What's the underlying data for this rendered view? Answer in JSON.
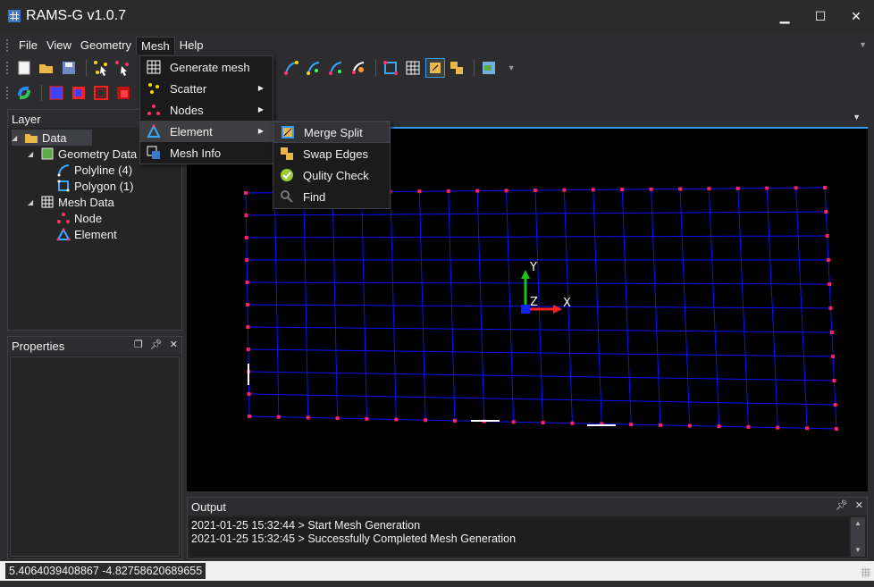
{
  "window": {
    "title": "RAMS-G v1.0.7",
    "minimize": "▁",
    "maximize": "☐",
    "close": "✕"
  },
  "menubar": {
    "items": [
      {
        "label": "File"
      },
      {
        "label": "View"
      },
      {
        "label": "Geometry"
      },
      {
        "label": "Mesh"
      },
      {
        "label": "Help"
      }
    ],
    "active": "Mesh"
  },
  "mesh_menu": {
    "items": [
      {
        "label": "Generate mesh",
        "icon": "generate-mesh-icon",
        "has_submenu": false
      },
      {
        "label": "Scatter",
        "icon": "scatter-icon",
        "has_submenu": true
      },
      {
        "label": "Nodes",
        "icon": "nodes-icon",
        "has_submenu": true
      },
      {
        "label": "Element",
        "icon": "element-icon",
        "has_submenu": true
      },
      {
        "label": "Mesh Info",
        "icon": "mesh-info-icon",
        "has_submenu": false
      }
    ]
  },
  "element_menu": {
    "items": [
      {
        "label": "Merge Split",
        "icon": "merge-split-icon"
      },
      {
        "label": "Swap Edges",
        "icon": "swap-edges-icon"
      },
      {
        "label": "Qulity Check",
        "icon": "quality-check-icon"
      },
      {
        "label": "Find",
        "icon": "find-icon"
      }
    ]
  },
  "layer_panel": {
    "title": "Layer",
    "tree": {
      "root": "Data",
      "geometry": "Geometry Data",
      "polyline": "Polyline (4)",
      "polygon": "Polygon (1)",
      "mesh": "Mesh Data",
      "node": "Node",
      "element": "Element"
    }
  },
  "properties_panel": {
    "title": "Properties"
  },
  "output_panel": {
    "title": "Output",
    "lines": [
      "2021-01-25 15:32:44 > Start Mesh Generation",
      "2021-01-25 15:32:45 > Successfully Completed Mesh Generation"
    ]
  },
  "viewport": {
    "axis_x": "X",
    "axis_y": "Y",
    "axis_z": "Z",
    "mesh_line_color": "#1010ff",
    "node_color": "#ff2060"
  },
  "status": {
    "coordinates": "5.4064039408867 -4.82758620689655"
  },
  "colors": {
    "accent": "#3399ff",
    "background": "#2d2d30",
    "panel": "#252526"
  }
}
